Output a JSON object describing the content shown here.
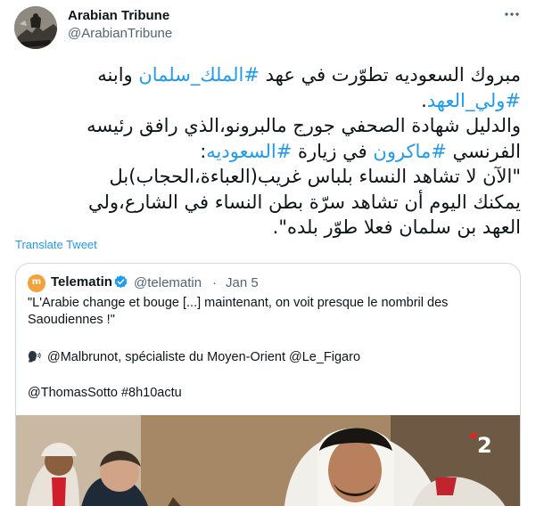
{
  "author": {
    "name": "Arabian Tribune",
    "handle": "@ArabianTribune"
  },
  "more_icon": "more-horizontal-icon",
  "tweet": {
    "lines": [
      [
        {
          "text": "مبروك السعوديه تطوّرت في عهد ",
          "hashtag": false
        },
        {
          "text": "#الملك_سلمان",
          "hashtag": true
        },
        {
          "text": " وابنه",
          "hashtag": false
        }
      ],
      [
        {
          "text": "#ولي_العهد",
          "hashtag": true
        },
        {
          "text": ".",
          "hashtag": false
        }
      ],
      [
        {
          "text": "والدليل شهادة الصحفي جورج مالبرونو،الذي رافق رئيسه",
          "hashtag": false
        }
      ],
      [
        {
          "text": "الفرنسي ",
          "hashtag": false
        },
        {
          "text": "#ماكرون",
          "hashtag": true
        },
        {
          "text": " في زيارة ",
          "hashtag": false
        },
        {
          "text": "#السعوديه",
          "hashtag": true
        },
        {
          "text": ":",
          "hashtag": false
        }
      ],
      [
        {
          "text": "\"الآن لا تشاهد النساء بلباس غريب(العباءة،الحجاب)بل",
          "hashtag": false
        }
      ],
      [
        {
          "text": "يمكنك اليوم أن تشاهد سرّة بطن النساء في الشارع،ولي",
          "hashtag": false
        }
      ],
      [
        {
          "text": "العهد بن سلمان فعلا طوّر بلده\".",
          "hashtag": false
        }
      ]
    ]
  },
  "translate_label": "Translate Tweet",
  "quote": {
    "avatar_letter": "m",
    "name": "Telematin",
    "verified_icon": "verified-badge-icon",
    "handle": "@telematin",
    "separator": "·",
    "date": "Jan 5",
    "line1": "\"L'Arabie change et bouge [...] maintenant, on voit presque le nombril des",
    "line2": "Saoudiennes !\"",
    "line3_icon": "speaking-head-icon",
    "line3": "@Malbrunot, spécialiste du Moyen-Orient @Le_Figaro",
    "line4": "@ThomasSotto #8h10actu",
    "media_logo": "2"
  },
  "colors": {
    "accent": "#1d9bf0",
    "text": "#0f1419",
    "secondary": "#536471",
    "border": "#cfd9de"
  }
}
